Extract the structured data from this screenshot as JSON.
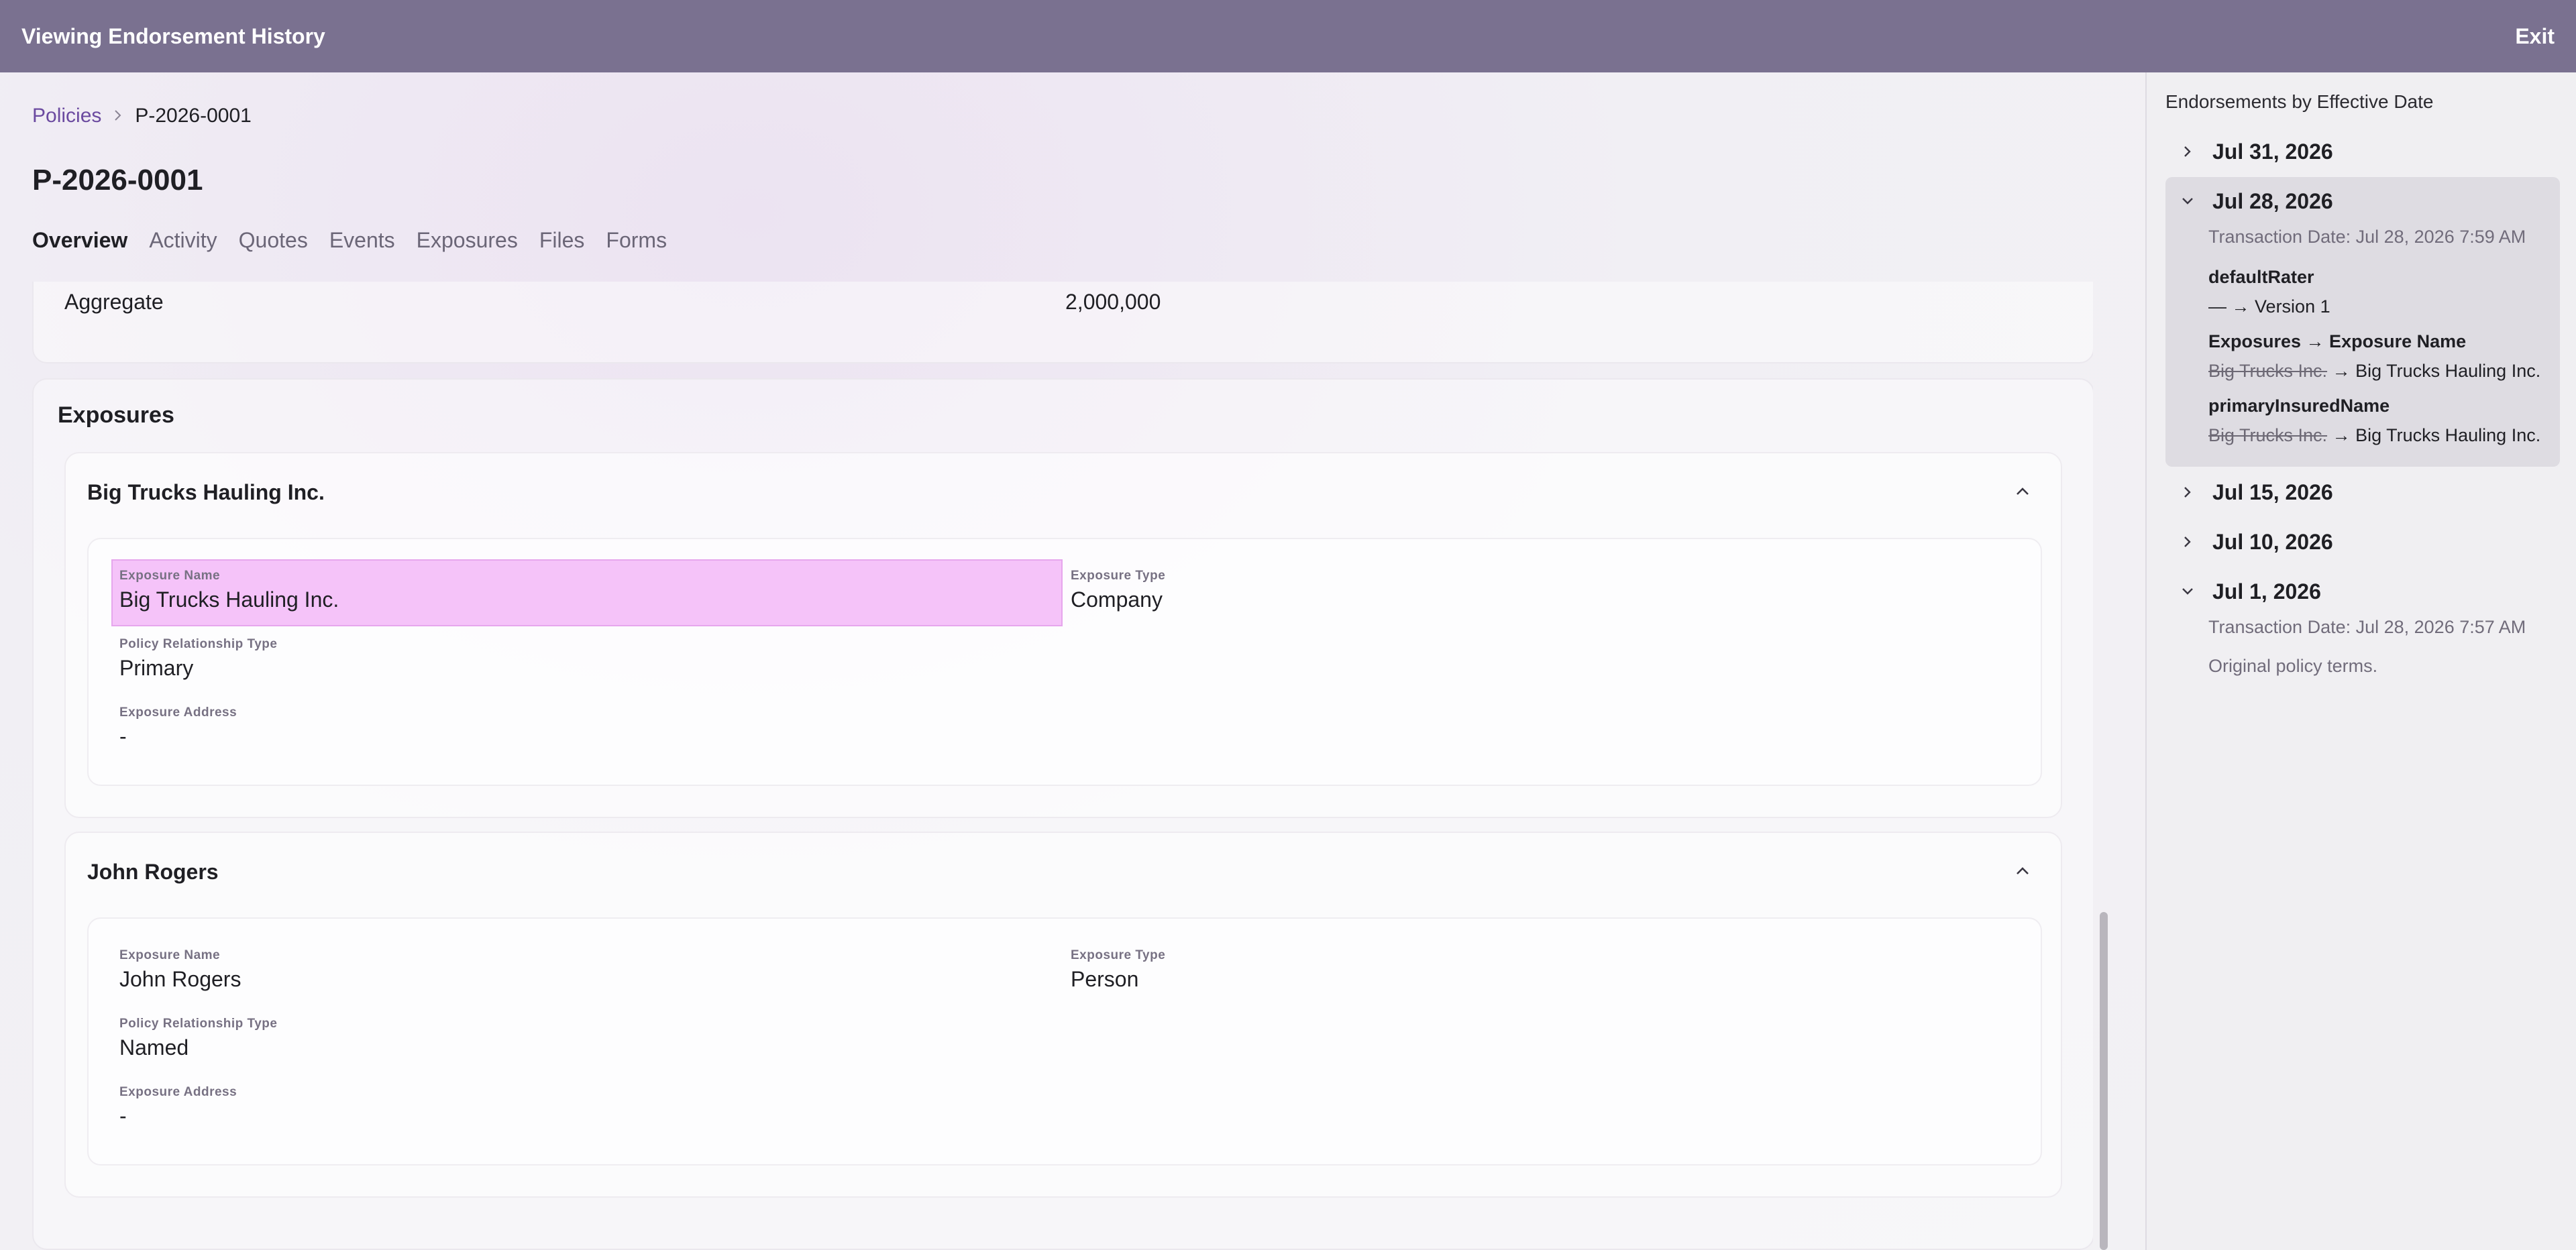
{
  "topbar": {
    "title": "Viewing Endorsement History",
    "exit": "Exit"
  },
  "breadcrumb": {
    "root": "Policies",
    "current": "P-2026-0001"
  },
  "page": {
    "title": "P-2026-0001"
  },
  "tabs": [
    "Overview",
    "Activity",
    "Quotes",
    "Events",
    "Exposures",
    "Files",
    "Forms"
  ],
  "aggregate": {
    "label": "Aggregate",
    "value": "2,000,000"
  },
  "exposures_section": {
    "heading": "Exposures",
    "items": [
      {
        "title": "Big Trucks Hauling Inc.",
        "name_label": "Exposure Name",
        "name": "Big Trucks Hauling Inc.",
        "type_label": "Exposure Type",
        "type": "Company",
        "rel_label": "Policy Relationship Type",
        "rel": "Primary",
        "addr_label": "Exposure Address",
        "addr": "-",
        "highlight_color": "#f5c3f9"
      },
      {
        "title": "John Rogers",
        "name_label": "Exposure Name",
        "name": "John Rogers",
        "type_label": "Exposure Type",
        "type": "Person",
        "rel_label": "Policy Relationship Type",
        "rel": "Named",
        "addr_label": "Exposure Address",
        "addr": "-"
      }
    ]
  },
  "sidebar": {
    "title": "Endorsements by Effective Date",
    "entries": [
      {
        "date": "Jul 31, 2026",
        "expanded": false
      },
      {
        "date": "Jul 28, 2026",
        "expanded": true,
        "transaction": "Transaction Date: Jul 28, 2026 7:59 AM",
        "changes": [
          {
            "field": "defaultRater",
            "old": "—",
            "arrow": "→",
            "new": "Version 1"
          },
          {
            "field": "Exposures → Exposure Name",
            "old": "Big Trucks Inc.",
            "arrow": "→",
            "new": "Big Trucks Hauling Inc."
          },
          {
            "field": "primaryInsuredName",
            "old": "Big Trucks Inc.",
            "arrow": "→",
            "new": "Big Trucks Hauling Inc."
          }
        ]
      },
      {
        "date": "Jul 15, 2026",
        "expanded": false
      },
      {
        "date": "Jul 10, 2026",
        "expanded": false
      },
      {
        "date": "Jul 1, 2026",
        "expanded": true,
        "transaction": "Transaction Date: Jul 28, 2026 7:57 AM",
        "note": "Original policy terms."
      }
    ]
  },
  "colors": {
    "topbar": "#7a7190",
    "link": "#6b4aa0",
    "highlight": "#f5c3f9"
  }
}
